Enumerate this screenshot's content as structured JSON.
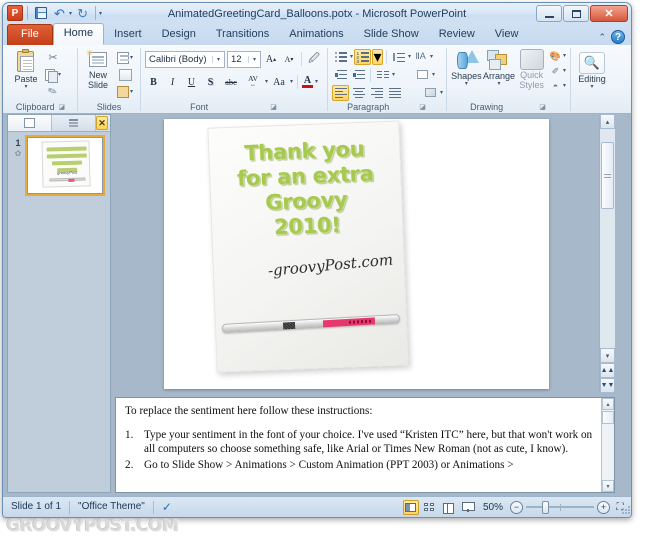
{
  "window": {
    "title": "AnimatedGreetingCard_Balloons.potx - Microsoft PowerPoint",
    "minimize_label": "Minimize",
    "maximize_label": "Maximize",
    "close_label": "✕"
  },
  "quick_access": {
    "app_logo": "P",
    "save_label": "Save",
    "undo_label": "Undo",
    "undo_caret": "▾",
    "redo_label": "Redo",
    "customize_caret": "▾"
  },
  "ribbon": {
    "tabs": [
      {
        "label": "File",
        "type": "file"
      },
      {
        "label": "Home",
        "type": "active"
      },
      {
        "label": "Insert",
        "type": "normal"
      },
      {
        "label": "Design",
        "type": "normal"
      },
      {
        "label": "Transitions",
        "type": "normal"
      },
      {
        "label": "Animations",
        "type": "normal"
      },
      {
        "label": "Slide Show",
        "type": "normal"
      },
      {
        "label": "Review",
        "type": "normal"
      },
      {
        "label": "View",
        "type": "normal"
      }
    ],
    "minimize_ribbon": "⌃",
    "help": "?",
    "groups": {
      "clipboard": {
        "label": "Clipboard",
        "paste_label": "Paste",
        "paste_caret": "▾",
        "cut_label": "Cut",
        "copy_label": "Copy",
        "copy_caret": "▾",
        "format_painter_label": "Format Painter",
        "dialog_launcher": "◪"
      },
      "slides": {
        "label": "Slides",
        "new_slide_line1": "New",
        "new_slide_line2": "Slide",
        "new_slide_caret": "▾",
        "layout_label": "Layout",
        "layout_caret": "▾",
        "reset_label": "Reset",
        "section_label": "Section",
        "section_caret": "▾"
      },
      "font": {
        "label": "Font",
        "font_name": "Calibri (Body)",
        "font_size": "12",
        "combo_caret": "▾",
        "grow_font": "A",
        "grow_mark": "▴",
        "shrink_font": "A",
        "shrink_mark": "▾",
        "clear_formatting": "Clear Formatting",
        "bold": "B",
        "italic": "I",
        "underline": "U",
        "shadow": "S",
        "strikethrough": "abc",
        "char_spacing": "AV",
        "char_spacing_caret": "▾",
        "change_case": "Aa",
        "change_case_caret": "▾",
        "font_color": "A",
        "font_color_caret": "▾",
        "font_color_hex": "#cc1111",
        "dialog_launcher": "◪"
      },
      "paragraph": {
        "label": "Paragraph",
        "bullets_label": "Bullets",
        "bullets_caret": "▾",
        "numbering_label": "Numbering",
        "numbering_caret": "▾",
        "line_spacing_label": "Line Spacing",
        "line_spacing_caret": "▾",
        "text_direction_label": "Text Direction",
        "text_direction_caret": "▾",
        "decrease_indent": "Decrease List Level",
        "increase_indent": "Increase List Level",
        "columns_label": "Columns",
        "columns_caret": "▾",
        "align_text_label": "Align Text",
        "align_text_caret": "▾",
        "align_left": "Align Left",
        "align_center": "Center",
        "align_right": "Align Right",
        "align_justify": "Justify",
        "convert_smartart": "Convert to SmartArt",
        "convert_caret": "▾",
        "dialog_launcher": "◪"
      },
      "drawing": {
        "label": "Drawing",
        "shapes_label": "Shapes",
        "shapes_caret": "▾",
        "arrange_label": "Arrange",
        "arrange_caret": "▾",
        "quick_styles_line1": "Quick",
        "quick_styles_line2": "Styles",
        "quick_styles_caret": "▾",
        "shape_fill": "Shape Fill",
        "shape_fill_caret": "▾",
        "shape_outline": "Shape Outline",
        "shape_outline_caret": "▾",
        "shape_effects": "Shape Effects",
        "shape_effects_caret": "▾",
        "dialog_launcher": "◪"
      },
      "editing": {
        "label": "",
        "editing_label": "Editing",
        "editing_caret": "▾"
      }
    }
  },
  "slides_pane": {
    "tab_slides": "Slides",
    "tab_outline": "Outline",
    "close_label": "✕",
    "thumbnails": [
      {
        "number": "1",
        "star": "✿"
      }
    ]
  },
  "slide": {
    "card_lines": [
      "Thank you",
      "for an extra",
      "Groovy",
      "2010!"
    ],
    "signature": "-groovyPost.com",
    "text_color": "#a8c94f",
    "pen_label_color": "#e8376f"
  },
  "notes": {
    "intro": "To replace the sentiment here follow these instructions:",
    "items": [
      {
        "number": "1.",
        "text": "Type your sentiment in the font of your choice. I've used “Kristen ITC” here, but that won't work on all computers so choose something safe, like Arial or Times New Roman (not as cute, I know)."
      },
      {
        "number": "2.",
        "text": "Go to Slide Show > Animations > Custom Animation (PPT 2003) or Animations >"
      }
    ],
    "scroll_up": "▴",
    "scroll_down": "▾"
  },
  "scrollbars": {
    "up_arrow": "▴",
    "down_arrow": "▾",
    "left_arrow": "◂",
    "right_arrow": "▸",
    "previous_slide": "▴",
    "next_slide": "▾"
  },
  "status_bar": {
    "slide_count": "Slide 1 of 1",
    "theme": "\"Office Theme\"",
    "spell_check": "Spelling Check",
    "views": [
      {
        "name": "Normal",
        "active": true
      },
      {
        "name": "Slide Sorter",
        "active": false
      },
      {
        "name": "Reading View",
        "active": false
      },
      {
        "name": "Slide Show",
        "active": false
      }
    ],
    "zoom_level": "50%",
    "zoom_out": "−",
    "zoom_in": "+",
    "fit_to_window": "⛶"
  },
  "watermark": "GROOVYPOST.COM"
}
